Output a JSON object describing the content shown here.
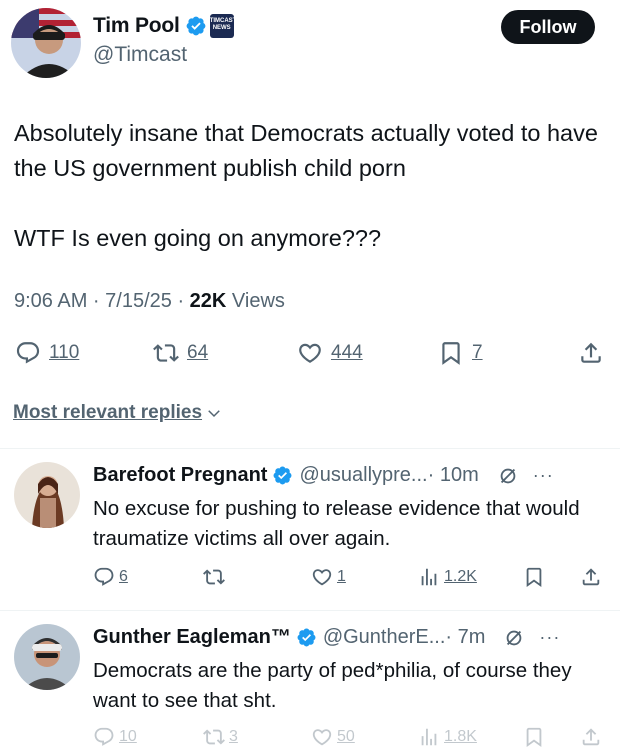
{
  "tweet": {
    "author": {
      "name": "Tim Pool",
      "handle": "@Timcast",
      "badge_text": "TIMCAST NEWS"
    },
    "follow_label": "Follow",
    "text": "Absolutely insane that Democrats actually voted to have the US government publish child porn\n\nWTF Is even going on anymore???",
    "time": "9:06 AM · 7/15/25 · ",
    "views_count": "22K",
    "views_label": " Views",
    "stats": {
      "replies": "110",
      "reposts": "64",
      "likes": "444",
      "bookmarks": "7"
    }
  },
  "replies_sort_label": "Most relevant replies",
  "replies": [
    {
      "name": "Barefoot Pregnant",
      "handle": "@usuallypre...",
      "time": " · 10m",
      "text": "No excuse for pushing to release evidence that would traumatize victims all over again.",
      "replies": "6",
      "reposts": "",
      "likes": "1",
      "views": "1.2K"
    },
    {
      "name": "Gunther Eagleman™",
      "handle": "@GuntherE...",
      "time": " · 7m",
      "text": "Democrats are the party of ped*philia, of course they want to see that sht.",
      "replies": "10",
      "reposts": "3",
      "likes": "50",
      "views": "1.8K"
    }
  ],
  "colors": {
    "text": "#0f1419",
    "secondary": "#536471",
    "verified": "#1d9bf0",
    "divider": "#eff3f4"
  }
}
